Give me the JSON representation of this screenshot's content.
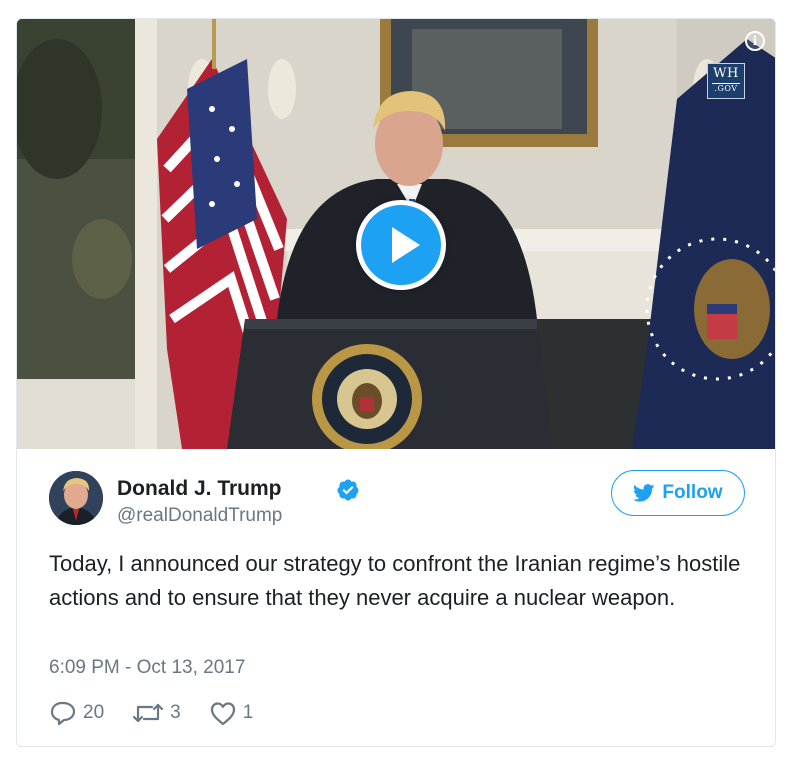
{
  "video": {
    "badge_top": "WH",
    "badge_bottom": ".GOV",
    "info_glyph": "i",
    "seal_text": "PRESIDENT OF THE UNITED STATES",
    "play_icon": "play-icon"
  },
  "tweet": {
    "display_name": "Donald J. Trump",
    "screen_name": "@realDonaldTrump",
    "verified_icon": "verified-badge-icon",
    "follow_label": "Follow",
    "follow_icon": "twitter-bird-icon",
    "text": "Today, I announced our strategy to confront the Iranian regime’s hostile actions and to ensure that they never acquire a nuclear weapon.",
    "timestamp": "6:09 PM - Oct 13, 2017",
    "replies": "20",
    "retweets": "3",
    "likes": "1"
  },
  "colors": {
    "accent": "#1da1f2",
    "text": "#1c2022",
    "secondary_text": "#697882",
    "border": "#e1e8ed"
  }
}
